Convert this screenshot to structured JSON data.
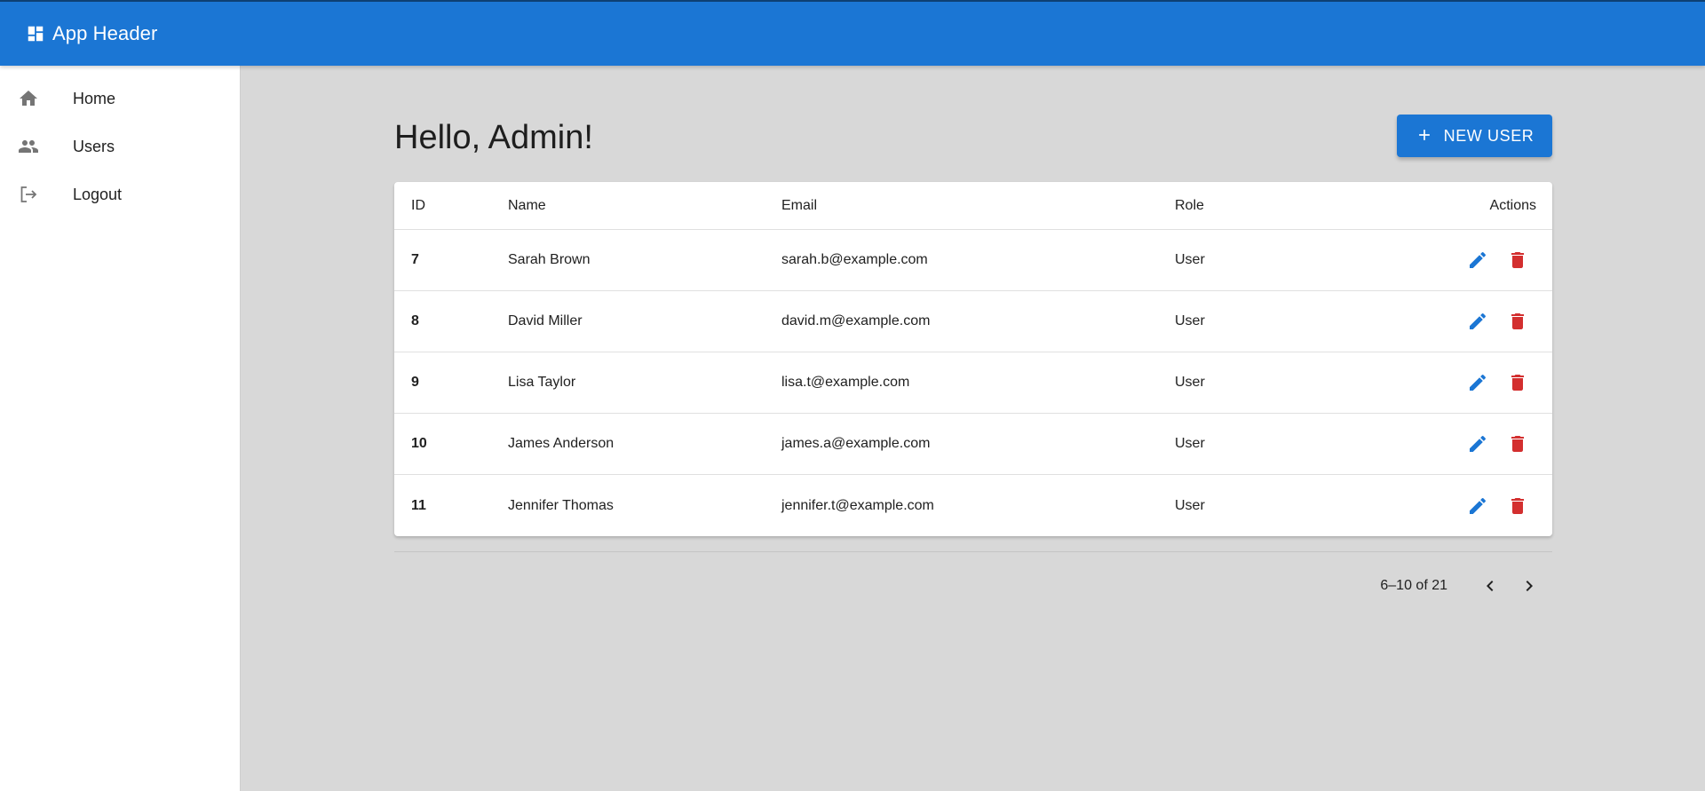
{
  "app": {
    "title": "App Header",
    "logo_icon": "dashboard-icon",
    "accent": "#1b76d4"
  },
  "sidebar": {
    "items": [
      {
        "label": "Home",
        "icon": "home-icon"
      },
      {
        "label": "Users",
        "icon": "people-icon"
      },
      {
        "label": "Logout",
        "icon": "logout-icon"
      }
    ]
  },
  "main": {
    "greeting": "Hello, Admin!",
    "new_user_label": "NEW USER",
    "new_user_icon": "plus-icon"
  },
  "table": {
    "columns": [
      "ID",
      "Name",
      "Email",
      "Role",
      "Actions"
    ],
    "rows": [
      {
        "id": "7",
        "name": "Sarah Brown",
        "email": "sarah.b@example.com",
        "role": "User"
      },
      {
        "id": "8",
        "name": "David Miller",
        "email": "david.m@example.com",
        "role": "User"
      },
      {
        "id": "9",
        "name": "Lisa Taylor",
        "email": "lisa.t@example.com",
        "role": "User"
      },
      {
        "id": "10",
        "name": "James Anderson",
        "email": "james.a@example.com",
        "role": "User"
      },
      {
        "id": "11",
        "name": "Jennifer Thomas",
        "email": "jennifer.t@example.com",
        "role": "User"
      }
    ],
    "edit_icon": "pencil-icon",
    "delete_icon": "trash-icon",
    "edit_color": "#1b76d4",
    "delete_color": "#d32f2f"
  },
  "pagination": {
    "range": "6–10 of 21",
    "prev_icon": "chevron-left-icon",
    "next_icon": "chevron-right-icon"
  }
}
